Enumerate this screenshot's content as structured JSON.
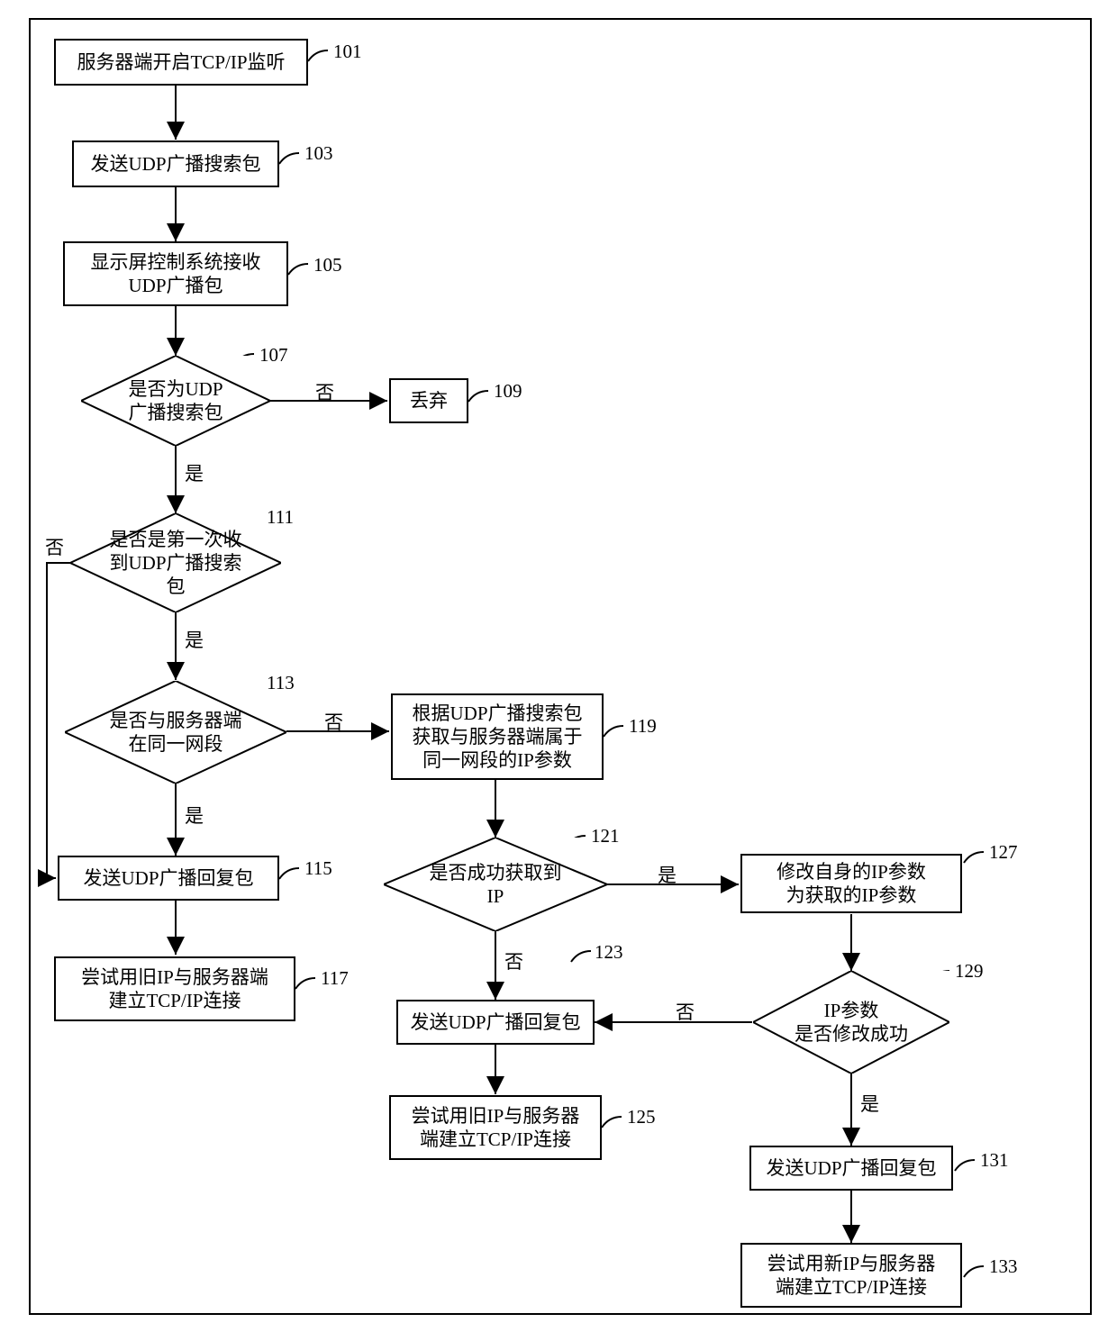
{
  "chart_data": {
    "type": "flowchart",
    "nodes": [
      {
        "id": "101",
        "shape": "rect",
        "text": "服务器端开启TCP/IP监听",
        "ref": "101"
      },
      {
        "id": "103",
        "shape": "rect",
        "text": "发送UDP广播搜索包",
        "ref": "103"
      },
      {
        "id": "105",
        "shape": "rect",
        "text": "显示屏控制系统接收UDP广播包",
        "ref": "105"
      },
      {
        "id": "107",
        "shape": "diamond",
        "text": "是否为UDP广播搜索包",
        "ref": "107"
      },
      {
        "id": "109",
        "shape": "rect",
        "text": "丢弃",
        "ref": "109"
      },
      {
        "id": "111",
        "shape": "diamond",
        "text": "是否是第一次收到UDP广播搜索包",
        "ref": "111"
      },
      {
        "id": "113",
        "shape": "diamond",
        "text": "是否与服务器端在同一网段",
        "ref": "113"
      },
      {
        "id": "115",
        "shape": "rect",
        "text": "发送UDP广播回复包",
        "ref": "115"
      },
      {
        "id": "117",
        "shape": "rect",
        "text": "尝试用旧IP与服务器端建立TCP/IP连接",
        "ref": "117"
      },
      {
        "id": "119",
        "shape": "rect",
        "text": "根据UDP广播搜索包获取与服务器端属于同一网段的IP参数",
        "ref": "119"
      },
      {
        "id": "121",
        "shape": "diamond",
        "text": "是否成功获取到IP",
        "ref": "121"
      },
      {
        "id": "123",
        "shape": "rect",
        "text": "发送UDP广播回复包",
        "ref": "123"
      },
      {
        "id": "125",
        "shape": "rect",
        "text": "尝试用旧IP与服务器端建立TCP/IP连接",
        "ref": "125"
      },
      {
        "id": "127",
        "shape": "rect",
        "text": "修改自身的IP参数为获取的IP参数",
        "ref": "127"
      },
      {
        "id": "129",
        "shape": "diamond",
        "text": "IP参数是否修改成功",
        "ref": "129"
      },
      {
        "id": "131",
        "shape": "rect",
        "text": "发送UDP广播回复包",
        "ref": "131"
      },
      {
        "id": "133",
        "shape": "rect",
        "text": "尝试用新IP与服务器端建立TCP/IP连接",
        "ref": "133"
      }
    ],
    "edges": [
      {
        "from": "101",
        "to": "103"
      },
      {
        "from": "103",
        "to": "105"
      },
      {
        "from": "105",
        "to": "107"
      },
      {
        "from": "107",
        "to": "109",
        "label": "否"
      },
      {
        "from": "107",
        "to": "111",
        "label": "是"
      },
      {
        "from": "111",
        "to": "115",
        "label": "否"
      },
      {
        "from": "111",
        "to": "113",
        "label": "是"
      },
      {
        "from": "113",
        "to": "115",
        "label": "是"
      },
      {
        "from": "113",
        "to": "119",
        "label": "否"
      },
      {
        "from": "115",
        "to": "117"
      },
      {
        "from": "119",
        "to": "121"
      },
      {
        "from": "121",
        "to": "123",
        "label": "否"
      },
      {
        "from": "121",
        "to": "127",
        "label": "是"
      },
      {
        "from": "123",
        "to": "125"
      },
      {
        "from": "127",
        "to": "129"
      },
      {
        "from": "129",
        "to": "123",
        "label": "否"
      },
      {
        "from": "129",
        "to": "131",
        "label": "是"
      },
      {
        "from": "131",
        "to": "133"
      }
    ]
  },
  "nodes": {
    "n101": "服务器端开启TCP/IP监听",
    "n103": "发送UDP广播搜索包",
    "n105": "显示屏控制系统接收\nUDP广播包",
    "n107": "是否为UDP\n广播搜索包",
    "n109": "丢弃",
    "n111": "是否是第一次收\n到UDP广播搜索包",
    "n113": "是否与服务器端\n在同一网段",
    "n115": "发送UDP广播回复包",
    "n117": "尝试用旧IP与服务器端\n建立TCP/IP连接",
    "n119": "根据UDP广播搜索包\n获取与服务器端属于\n同一网段的IP参数",
    "n121": "是否成功获取到IP",
    "n123": "发送UDP广播回复包",
    "n125": "尝试用旧IP与服务器\n端建立TCP/IP连接",
    "n127": "修改自身的IP参数\n为获取的IP参数",
    "n129": "IP参数\n是否修改成功",
    "n131": "发送UDP广播回复包",
    "n133": "尝试用新IP与服务器\n端建立TCP/IP连接"
  },
  "refs": {
    "r101": "101",
    "r103": "103",
    "r105": "105",
    "r107": "107",
    "r109": "109",
    "r111": "111",
    "r113": "113",
    "r115": "115",
    "r117": "117",
    "r119": "119",
    "r121": "121",
    "r123": "123",
    "r125": "125",
    "r127": "127",
    "r129": "129",
    "r131": "131",
    "r133": "133"
  },
  "labels": {
    "yes": "是",
    "no": "否"
  }
}
